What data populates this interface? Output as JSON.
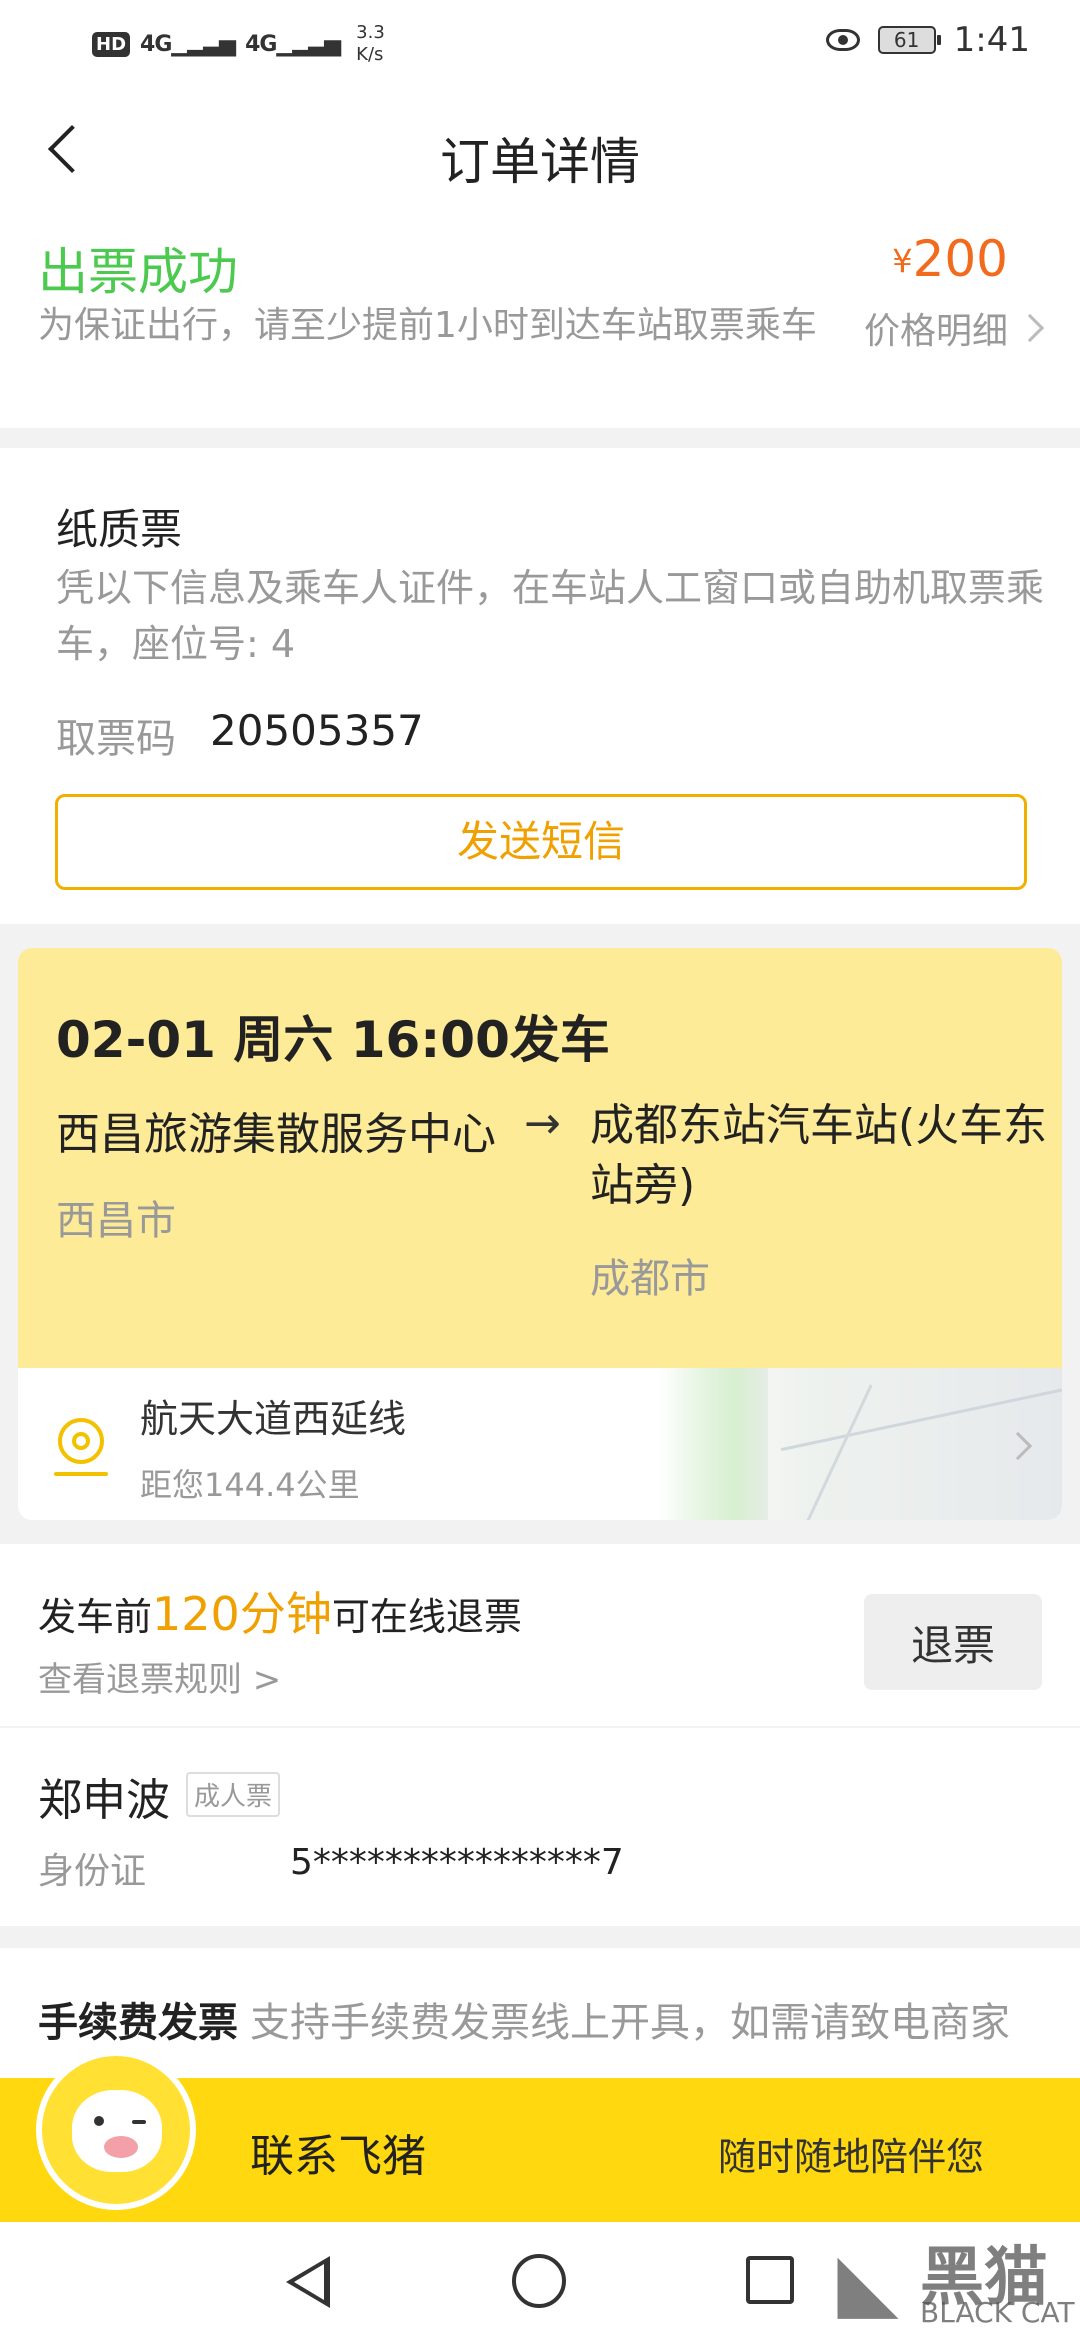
{
  "status_bar": {
    "hd": "HD",
    "sim1": "4G",
    "sim2": "4G",
    "speed_value": "3.3",
    "speed_unit": "K/s",
    "battery": "61",
    "time": "1:41"
  },
  "header": {
    "title": "订单详情"
  },
  "order_status": {
    "status": "出票成功",
    "price_symbol": "¥",
    "price": "200",
    "tip": "为保证出行，请至少提前1小时到达车站取票乘车",
    "price_detail": "价格明细"
  },
  "paper_ticket": {
    "title": "纸质票",
    "description": "凭以下信息及乘车人证件，在车站人工窗口或自助机取票乘车，座位号: 4",
    "code_label": "取票码",
    "code": "20505357",
    "sms_button": "发送短信"
  },
  "trip": {
    "departure_time": "02-01 周六 16:00发车",
    "from_station": "西昌旅游集散服务中心",
    "arrow": "→",
    "to_station": "成都东站汽车站(火车东站旁)",
    "from_city": "西昌市",
    "to_city": "成都市",
    "boarding_point": "航天大道西延线",
    "distance": "距您144.4公里"
  },
  "refund": {
    "prefix": "发车前",
    "minutes": "120分钟",
    "suffix": "可在线退票",
    "rules_link": "查看退票规则 >",
    "button": "退票"
  },
  "passenger": {
    "name": "郑申波",
    "ticket_type": "成人票",
    "id_label": "身份证",
    "id_number": "5****************7"
  },
  "invoice": {
    "title": "手续费发票",
    "text": "支持手续费发票线上开具，如需请致电商家"
  },
  "contact": {
    "label": "联系飞猪",
    "slogan": "随时随地陪伴您"
  },
  "watermark": {
    "big": "黑猫",
    "small": "BLACK CAT"
  },
  "colors": {
    "success": "#4cc94f",
    "price": "#f26a1b",
    "accent": "#f0a000",
    "trip_bg": "#fdeb98",
    "contact_bg": "#ffd80f"
  }
}
